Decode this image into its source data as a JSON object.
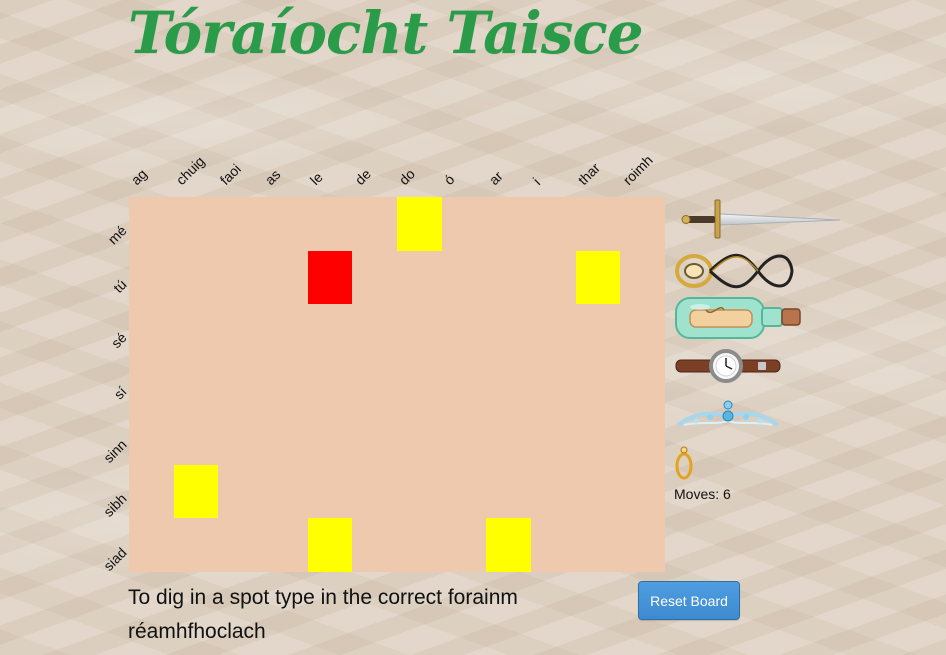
{
  "title": "Tóraíocht Taisce",
  "columns": [
    "ag",
    "chuig",
    "faoi",
    "as",
    "le",
    "de",
    "do",
    "ó",
    "ar",
    "i",
    "thar",
    "roimh"
  ],
  "rows": [
    "mé",
    "tú",
    "sé",
    "sí",
    "sinn",
    "sibh",
    "siad"
  ],
  "board": {
    "cells": [
      [
        0,
        0,
        0,
        0,
        0,
        0,
        1,
        0,
        0,
        0,
        0,
        0
      ],
      [
        0,
        0,
        0,
        0,
        2,
        0,
        0,
        0,
        0,
        0,
        1,
        0
      ],
      [
        0,
        0,
        0,
        0,
        0,
        0,
        0,
        0,
        0,
        0,
        0,
        0
      ],
      [
        0,
        0,
        0,
        0,
        0,
        0,
        0,
        0,
        0,
        0,
        0,
        0
      ],
      [
        0,
        0,
        0,
        0,
        0,
        0,
        0,
        0,
        0,
        0,
        0,
        0
      ],
      [
        0,
        1,
        0,
        0,
        0,
        0,
        0,
        0,
        0,
        0,
        0,
        0
      ],
      [
        0,
        0,
        0,
        0,
        1,
        0,
        0,
        0,
        1,
        0,
        0,
        0
      ]
    ],
    "colors": {
      "board": "#efc9ad",
      "yellow": "#ffff00",
      "red": "#ff0000"
    }
  },
  "treasures": [
    "sword-icon",
    "rings-icon",
    "bottle-icon",
    "watch-icon",
    "tiara-icon",
    "ring-icon"
  ],
  "moves": "Moves: 6",
  "instruction": "To dig in a spot type in the correct forainm réamhfhoclach",
  "reset_label": "Reset Board"
}
